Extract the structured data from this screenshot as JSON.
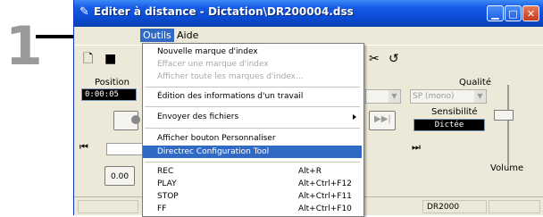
{
  "step_number": "1",
  "window": {
    "title": "Editer à distance - Dictation\\DR200004.dss",
    "controls": [
      "minimize-icon",
      "maximize-icon",
      "close-icon"
    ]
  },
  "menubar": {
    "items": [
      "Outils",
      "Aide"
    ],
    "active": "Outils"
  },
  "main": {
    "position_label": "Position",
    "position_value": "0:00:05",
    "quality_label": "Qualité",
    "quality_value": "SP (mono)",
    "sensitivity_label": "Sensibilité",
    "sensitivity_value": "Dictée",
    "volume_label": "Volume",
    "counter_value": "0.00"
  },
  "statusbar": {
    "device": "DR2000"
  },
  "outils_menu": {
    "items": [
      {
        "label": "Nouvelle marque d'index",
        "shortcut": "",
        "disabled": false
      },
      {
        "label": "Effacer une marque d'index",
        "shortcut": "",
        "disabled": true
      },
      {
        "label": "Afficher toute les marques d'index...",
        "shortcut": "",
        "disabled": true
      },
      {
        "label": "Édition des informations d'un travail",
        "shortcut": "",
        "disabled": false
      },
      {
        "label": "Envoyer des fichiers",
        "shortcut": "",
        "disabled": false,
        "submenu": true
      },
      {
        "label": "Afficher bouton Personnaliser",
        "shortcut": "",
        "disabled": false
      },
      {
        "label": "Directrec Configuration Tool",
        "shortcut": "",
        "disabled": false,
        "highlighted": true
      },
      {
        "label": "REC",
        "shortcut": "Alt+R",
        "disabled": false
      },
      {
        "label": "PLAY",
        "shortcut": "Alt+Ctrl+F12",
        "disabled": false
      },
      {
        "label": "STOP",
        "shortcut": "Alt+Ctrl+F11",
        "disabled": false
      },
      {
        "label": "FF",
        "shortcut": "Alt+Ctrl+F10",
        "disabled": false
      }
    ]
  }
}
